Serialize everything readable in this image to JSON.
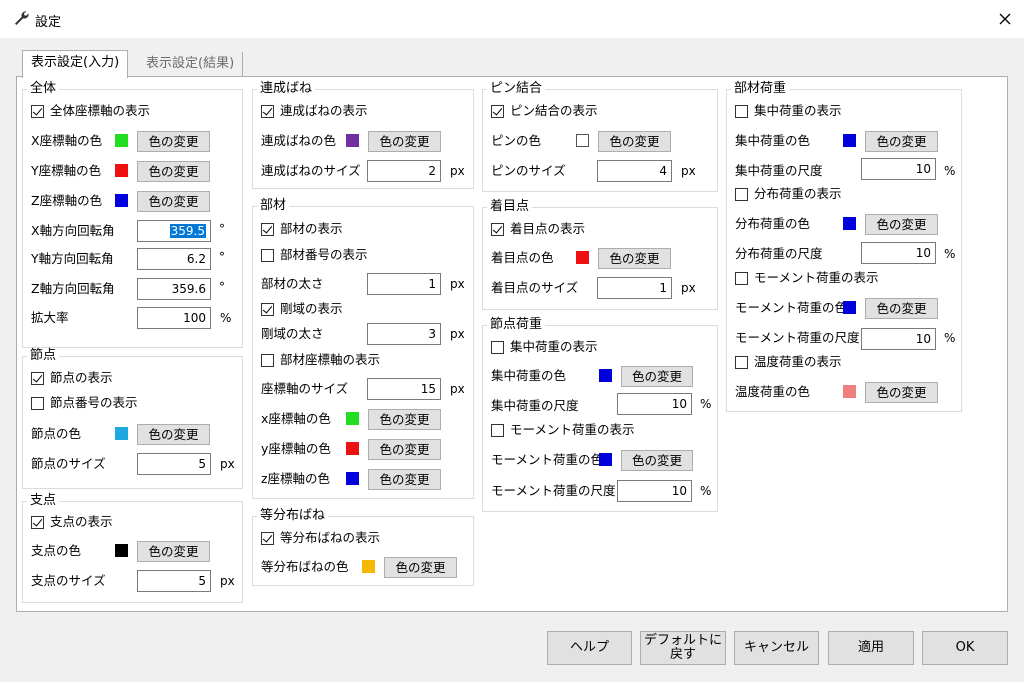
{
  "window": {
    "title": "設定"
  },
  "tabs": [
    {
      "label": "表示設定(入力)"
    },
    {
      "label": "表示設定(結果)"
    }
  ],
  "colors": {
    "green": "#22dd22",
    "red": "#ee1111",
    "blue": "#0000dd",
    "cyan": "#20a8e0",
    "black": "#000000",
    "purple": "#7030a0",
    "white": "#ffffff",
    "yellow": "#f5b800",
    "pink": "#f08080"
  },
  "common": {
    "change_color": "色の変更",
    "unit_px": "px",
    "unit_deg": "°",
    "unit_pct": "%"
  },
  "zentai": {
    "title": "全体",
    "show_axes": "全体座標軸の表示",
    "x_color": "X座標軸の色",
    "y_color": "Y座標軸の色",
    "z_color": "Z座標軸の色",
    "x_rot": "X軸方向回転角",
    "y_rot": "Y軸方向回転角",
    "z_rot": "Z軸方向回転角",
    "x_rot_val": "359.5",
    "y_rot_val": "6.2",
    "z_rot_val": "359.6",
    "scale": "拡大率",
    "scale_val": "100"
  },
  "setten": {
    "title": "節点",
    "show": "節点の表示",
    "show_num": "節点番号の表示",
    "color": "節点の色",
    "size": "節点のサイズ",
    "size_val": "5"
  },
  "shiten": {
    "title": "支点",
    "show": "支点の表示",
    "color": "支点の色",
    "size": "支点のサイズ",
    "size_val": "5"
  },
  "rensei": {
    "title": "連成ばね",
    "show": "連成ばねの表示",
    "color": "連成ばねの色",
    "size": "連成ばねのサイズ",
    "size_val": "2"
  },
  "buzai": {
    "title": "部材",
    "show": "部材の表示",
    "show_num": "部材番号の表示",
    "thickness": "部材の太さ",
    "thickness_val": "1",
    "show_rigid": "剛域の表示",
    "rigid_thickness": "剛域の太さ",
    "rigid_val": "3",
    "show_axes": "部材座標軸の表示",
    "axis_size": "座標軸のサイズ",
    "axis_size_val": "15",
    "x_color": "x座標軸の色",
    "y_color": "y座標軸の色",
    "z_color": "z座標軸の色"
  },
  "toubunpu": {
    "title": "等分布ばね",
    "show": "等分布ばねの表示",
    "color": "等分布ばねの色"
  },
  "pin": {
    "title": "ピン結合",
    "show": "ピン結合の表示",
    "color": "ピンの色",
    "size": "ピンのサイズ",
    "size_val": "4"
  },
  "chakumoku": {
    "title": "着目点",
    "show": "着目点の表示",
    "color": "着目点の色",
    "size": "着目点のサイズ",
    "size_val": "1"
  },
  "nodeload": {
    "title": "節点荷重",
    "show_conc": "集中荷重の表示",
    "conc_color": "集中荷重の色",
    "conc_scale": "集中荷重の尺度",
    "conc_scale_val": "10",
    "show_moment": "モーメント荷重の表示",
    "moment_color": "モーメント荷重の色",
    "moment_scale": "モーメント荷重の尺度",
    "moment_scale_val": "10"
  },
  "memberload": {
    "title": "部材荷重",
    "show_conc": "集中荷重の表示",
    "conc_color": "集中荷重の色",
    "conc_scale": "集中荷重の尺度",
    "conc_scale_val": "10",
    "show_dist": "分布荷重の表示",
    "dist_color": "分布荷重の色",
    "dist_scale": "分布荷重の尺度",
    "dist_scale_val": "10",
    "show_moment": "モーメント荷重の表示",
    "moment_color": "モーメント荷重の色",
    "moment_scale": "モーメント荷重の尺度",
    "moment_scale_val": "10",
    "show_temp": "温度荷重の表示",
    "temp_color": "温度荷重の色"
  },
  "footer": {
    "help": "ヘルプ",
    "default_1": "デフォルトに",
    "default_2": "戻す",
    "cancel": "キャンセル",
    "apply": "適用",
    "ok": "OK"
  }
}
